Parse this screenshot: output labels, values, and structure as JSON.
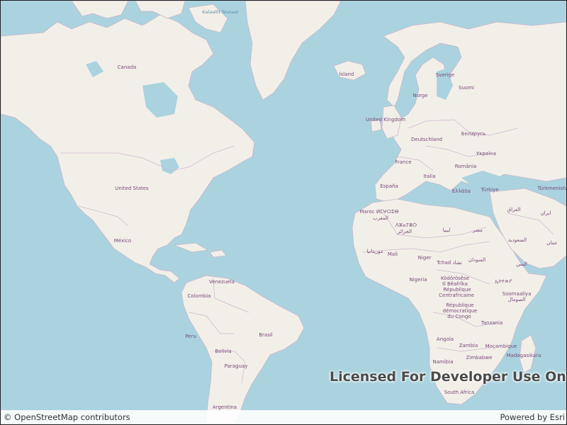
{
  "map": {
    "basemap": "OpenStreetMap",
    "colors": {
      "water": "#aad3df",
      "land": "#f2efe9",
      "border": "#c9b3c8",
      "label": "#7a4a7a"
    },
    "sea_labels": [
      "Kalaallit Nunaat"
    ],
    "country_labels": {
      "canada": "Canada",
      "united_states": "United States",
      "mexico": "México",
      "venezuela": "Venezuela",
      "colombia": "Colombia",
      "peru": "Peru",
      "brasil": "Brasil",
      "bolivia": "Bolivia",
      "paraguay": "Paraguay",
      "argentina": "Argentina",
      "island": "Ísland",
      "sverige": "Sverige",
      "suomi": "Suomi",
      "norge": "Norge",
      "united_kingdom": "United Kingdom",
      "deutschland": "Deutschland",
      "belarus": "Беларусь",
      "ukraina": "Україна",
      "france": "France",
      "romania": "România",
      "italia": "Italia",
      "espana": "España",
      "ellada": "Ελλάδα",
      "turkiye": "Türkiye",
      "turkmenistan": "Türkmenistan",
      "maroc": "Maroc ⵍⵎⵖⵔⵉⴱ",
      "maroc_ar": "المغرب",
      "algerie": "ⴷⵣⴰⵢⴻⵔ",
      "algerie_ar": "الجزائر",
      "libya": "ليبيا",
      "egypt": "مصر",
      "iraq": "العراق",
      "iran": "ایران",
      "saudi": "السعودية",
      "oman": "عمان",
      "yemen": "اليمن",
      "mauritanie": "موريتانيا",
      "mali": "Mali",
      "niger": "Niger",
      "tchad": "Tchad تشاد",
      "sudan": "السودان",
      "ethiopia": "ኢትዮጵያ",
      "nigeria": "Nigeria",
      "car_1": "Ködörösêse",
      "car_2": "tî Bêafrîka",
      "car_3": "République",
      "car_4": "Centrafricaine",
      "somalia_1": "Soomaaliya",
      "somalia_2": "الصومال",
      "drc_1": "République",
      "drc_2": "démocratique",
      "drc_3": "du Congo",
      "tanzania": "Tanzania",
      "angola": "Angola",
      "zambia": "Zambia",
      "mocambique": "Moçambique",
      "zimbabwe": "Zimbabwe",
      "namibia": "Namibia",
      "madagasikara": "Madagasikara",
      "south_africa": "South Africa"
    }
  },
  "watermark": "Licensed For Developer Use Only",
  "attribution": {
    "left": "© OpenStreetMap contributors",
    "right": "Powered by Esri"
  }
}
